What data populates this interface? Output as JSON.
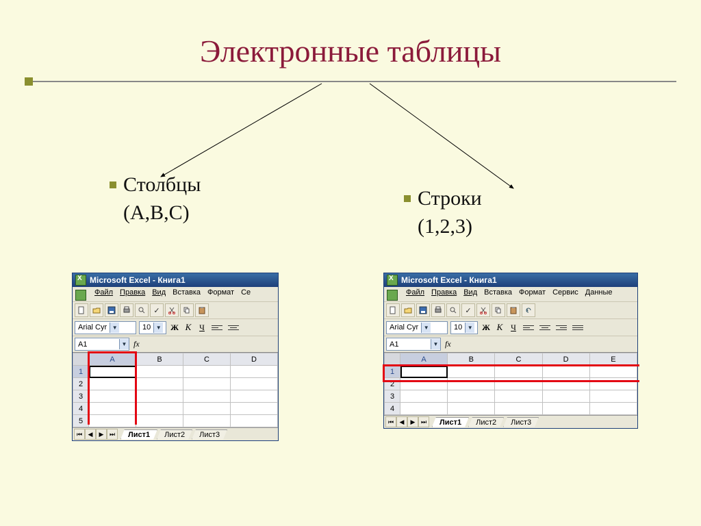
{
  "title": "Электронные таблицы",
  "labels": {
    "columns_title": "Столбцы",
    "columns_sub": "(А,В,С)",
    "rows_title": "Строки",
    "rows_sub": "(1,2,3)"
  },
  "excel": {
    "window_title": "Microsoft Excel - Книга1",
    "menus": [
      "Файл",
      "Правка",
      "Вид",
      "Вставка",
      "Формат",
      "Сервис",
      "Данные"
    ],
    "menus_short": [
      "Файл",
      "Правка",
      "Вид",
      "Вставка",
      "Формат",
      "Се"
    ],
    "font_name": "Arial Cyr",
    "font_size": "10",
    "fmt_buttons": {
      "bold": "Ж",
      "italic": "К",
      "underline": "Ч"
    },
    "name_box": "A1",
    "fx_label": "fx",
    "col_headers_narrow": [
      "A",
      "B",
      "C",
      "D"
    ],
    "col_headers_wide": [
      "A",
      "B",
      "C",
      "D",
      "E"
    ],
    "row_headers": [
      "1",
      "2",
      "3",
      "4",
      "5"
    ],
    "row_headers_wide": [
      "1",
      "2",
      "3",
      "4"
    ],
    "sheet_tabs": [
      "Лист1",
      "Лист2",
      "Лист3"
    ],
    "nav": [
      "⏮",
      "◀",
      "▶",
      "⏭"
    ]
  }
}
